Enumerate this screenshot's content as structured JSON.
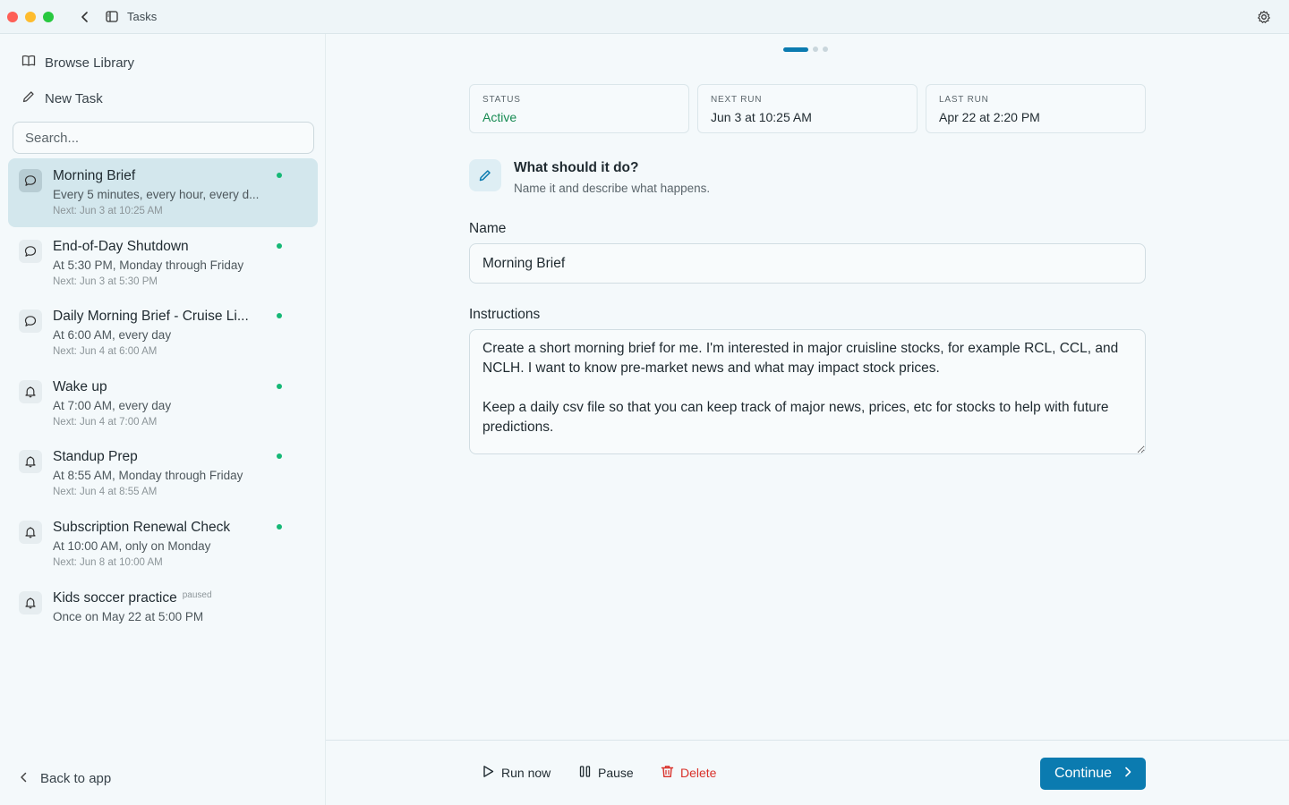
{
  "window": {
    "title": "Tasks"
  },
  "sidebar": {
    "browse_label": "Browse Library",
    "new_task_label": "New Task",
    "search_placeholder": "Search...",
    "back_label": "Back to app",
    "tasks": [
      {
        "title": "Morning Brief",
        "schedule": "Every 5 minutes, every hour, every d...",
        "next": "Next: Jun 3 at 10:25 AM",
        "icon": "chat-bubble-icon",
        "active": true,
        "selected": true,
        "badge": ""
      },
      {
        "title": "End-of-Day Shutdown",
        "schedule": "At 5:30 PM, Monday through Friday",
        "next": "Next: Jun 3 at 5:30 PM",
        "icon": "chat-bubble-icon",
        "active": true,
        "selected": false,
        "badge": ""
      },
      {
        "title": "Daily Morning Brief - Cruise Li...",
        "schedule": "At 6:00 AM, every day",
        "next": "Next: Jun 4 at 6:00 AM",
        "icon": "chat-bubble-icon",
        "active": true,
        "selected": false,
        "badge": ""
      },
      {
        "title": "Wake up",
        "schedule": "At 7:00 AM, every day",
        "next": "Next: Jun 4 at 7:00 AM",
        "icon": "bell-icon",
        "active": true,
        "selected": false,
        "badge": ""
      },
      {
        "title": "Standup Prep",
        "schedule": "At 8:55 AM, Monday through Friday",
        "next": "Next: Jun 4 at 8:55 AM",
        "icon": "bell-icon",
        "active": true,
        "selected": false,
        "badge": ""
      },
      {
        "title": "Subscription Renewal Check",
        "schedule": "At 10:00 AM, only on Monday",
        "next": "Next: Jun 8 at 10:00 AM",
        "icon": "bell-icon",
        "active": true,
        "selected": false,
        "badge": ""
      },
      {
        "title": "Kids soccer practice",
        "schedule": "Once on May 22 at 5:00 PM",
        "next": "",
        "icon": "bell-icon",
        "active": false,
        "selected": false,
        "badge": "paused"
      }
    ]
  },
  "main": {
    "stats": {
      "status_label": "STATUS",
      "status_value": "Active",
      "next_label": "NEXT RUN",
      "next_value": "Jun 3 at 10:25 AM",
      "last_label": "LAST RUN",
      "last_value": "Apr 22 at 2:20 PM"
    },
    "section": {
      "title": "What should it do?",
      "subtitle": "Name it and describe what happens."
    },
    "name_label": "Name",
    "name_value": "Morning Brief",
    "instructions_label": "Instructions",
    "instructions_value": "Create a short morning brief for me. I'm interested in major cruisline stocks, for example RCL, CCL, and NCLH. I want to know pre-market news and what may impact stock prices.\n\nKeep a daily csv file so that you can keep track of major news, prices, etc for stocks to help with future predictions."
  },
  "footer": {
    "run_now_label": "Run now",
    "pause_label": "Pause",
    "delete_label": "Delete",
    "continue_label": "Continue"
  },
  "colors": {
    "accent": "#0b7bb0",
    "active_green": "#16b876",
    "danger": "#d9312a"
  }
}
